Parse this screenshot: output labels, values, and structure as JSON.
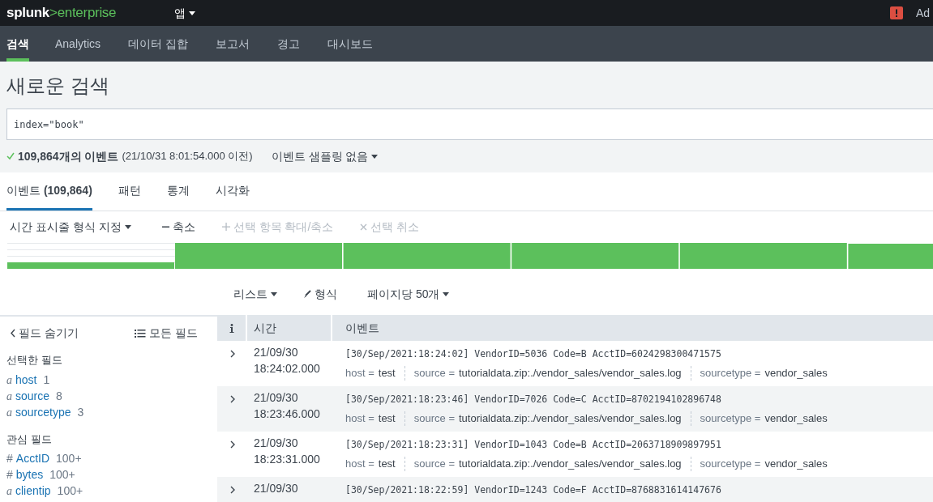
{
  "top_bar": {
    "logo": {
      "brand": "splunk",
      "product": ">enterprise"
    },
    "app_menu": "앱",
    "user": "Ad"
  },
  "nav_tabs": [
    {
      "label": "검색",
      "selected": true
    },
    {
      "label": "Analytics",
      "selected": false
    },
    {
      "label": "데이터 집합",
      "selected": false
    },
    {
      "label": "보고서",
      "selected": false
    },
    {
      "label": "경고",
      "selected": false
    },
    {
      "label": "대시보드",
      "selected": false
    }
  ],
  "page_title": "새로운 검색",
  "search": {
    "value": "index=\"book\""
  },
  "status": {
    "count": "109,864개의 이벤트",
    "time_range": "(21/10/31 8:01:54.000 이전)",
    "sampling": "이벤트 샘플링 없음"
  },
  "result_tabs": [
    {
      "label": "이벤트",
      "count": "(109,864)",
      "selected": true
    },
    {
      "label": "패턴",
      "selected": false
    },
    {
      "label": "통계",
      "selected": false
    },
    {
      "label": "시각화",
      "selected": false
    }
  ],
  "timeline_toolbar": [
    {
      "label": "시간 표시줄 형식 지정",
      "kind": "dropdown",
      "disabled": false
    },
    {
      "label": "축소",
      "kind": "minus",
      "disabled": false
    },
    {
      "label": "선택 항목 확대/축소",
      "kind": "plus",
      "disabled": true
    },
    {
      "label": "선택 취소",
      "kind": "clear",
      "disabled": true
    }
  ],
  "view_controls": [
    {
      "label": "리스트",
      "kind": "dropdown"
    },
    {
      "label": "형식",
      "kind": "brush"
    },
    {
      "label": "페이지당 50개",
      "kind": "dropdown"
    }
  ],
  "sidebar": {
    "hide_fields": "필드 숨기기",
    "all_fields": "모든 필드",
    "sections": [
      {
        "title": "선택한 필드",
        "fields": [
          {
            "type": "a",
            "name": "host",
            "count": "1"
          },
          {
            "type": "a",
            "name": "source",
            "count": "8"
          },
          {
            "type": "a",
            "name": "sourcetype",
            "count": "3"
          }
        ]
      },
      {
        "title": "관심 필드",
        "fields": [
          {
            "type": "#",
            "name": "AcctID",
            "count": "100+"
          },
          {
            "type": "#",
            "name": "bytes",
            "count": "100+"
          },
          {
            "type": "a",
            "name": "clientip",
            "count": "100+"
          }
        ]
      }
    ]
  },
  "table": {
    "columns": [
      "시간",
      "이벤트"
    ],
    "rows": [
      {
        "date": "21/09/30",
        "time": "18:24:02.000",
        "raw": "[30/Sep/2021:18:24:02] VendorID=5036 Code=B AcctID=6024298300471575",
        "fields": [
          {
            "key": "host =",
            "value": "test"
          },
          {
            "key": "source =",
            "value": "tutorialdata.zip:./vendor_sales/vendor_sales.log"
          },
          {
            "key": "sourcetype =",
            "value": "vendor_sales"
          }
        ]
      },
      {
        "date": "21/09/30",
        "time": "18:23:46.000",
        "raw": "[30/Sep/2021:18:23:46] VendorID=7026 Code=C AcctID=8702194102896748",
        "fields": [
          {
            "key": "host =",
            "value": "test"
          },
          {
            "key": "source =",
            "value": "tutorialdata.zip:./vendor_sales/vendor_sales.log"
          },
          {
            "key": "sourcetype =",
            "value": "vendor_sales"
          }
        ]
      },
      {
        "date": "21/09/30",
        "time": "18:23:31.000",
        "raw": "[30/Sep/2021:18:23:31] VendorID=1043 Code=B AcctID=2063718909897951",
        "fields": [
          {
            "key": "host =",
            "value": "test"
          },
          {
            "key": "source =",
            "value": "tutorialdata.zip:./vendor_sales/vendor_sales.log"
          },
          {
            "key": "sourcetype =",
            "value": "vendor_sales"
          }
        ]
      },
      {
        "date": "21/09/30",
        "raw": "[30/Sep/2021:18:22:59] VendorID=1243 Code=F AcctID=8768831614147676"
      }
    ]
  }
}
